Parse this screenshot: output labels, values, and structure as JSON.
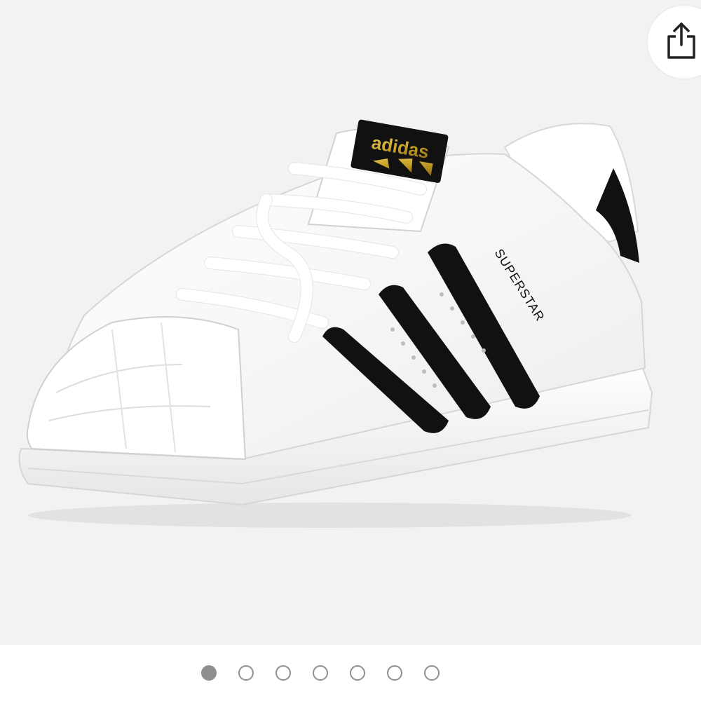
{
  "product_image": {
    "alt": "",
    "brand_tongue_text": "adidas",
    "side_text": "SUPERSTAR"
  },
  "share_button": {
    "icon": "share-icon"
  },
  "carousel": {
    "total": 7,
    "active_index": 0,
    "active_color": "#8f8f8f",
    "inactive_color": "#ffffff"
  },
  "colors": {
    "background": "#f2f2f2",
    "stripes": "#111111",
    "shoe": "#ffffff",
    "logo_gold": "#c9a227"
  }
}
